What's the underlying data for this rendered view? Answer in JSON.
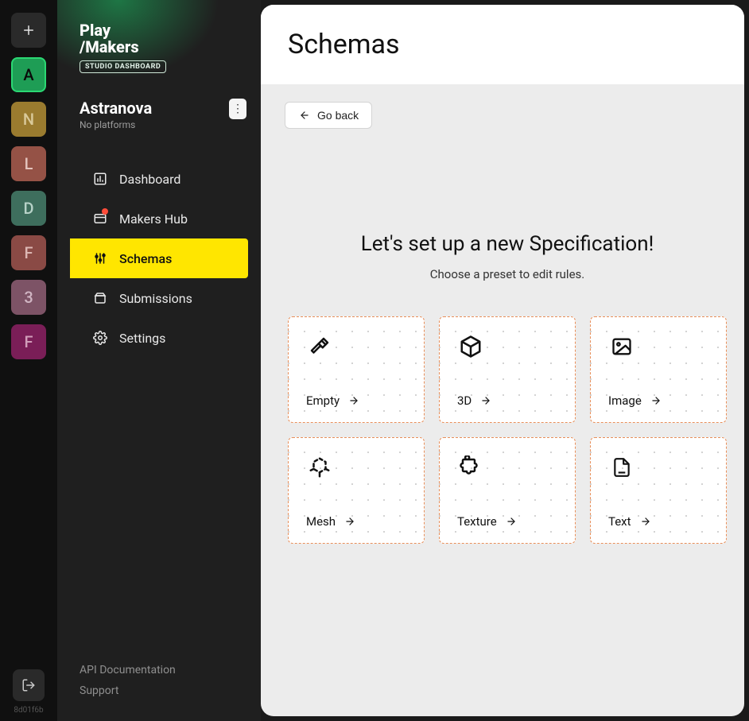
{
  "rail": {
    "tiles": [
      {
        "letter": "+",
        "bg": "#2a2a2a",
        "fg": "#e5e5e5",
        "active": false,
        "plus": true
      },
      {
        "letter": "A",
        "bg": "#1e9d55",
        "fg": "#0a0a0a",
        "active": true
      },
      {
        "letter": "N",
        "bg": "#9a7b2f",
        "fg": "#d9c999",
        "active": false
      },
      {
        "letter": "L",
        "bg": "#955246",
        "fg": "#e4c4bd",
        "active": false
      },
      {
        "letter": "D",
        "bg": "#3e6e5d",
        "fg": "#b7d2c8",
        "active": false
      },
      {
        "letter": "F",
        "bg": "#8a4a45",
        "fg": "#dcb7b3",
        "active": false
      },
      {
        "letter": "3",
        "bg": "#7d5366",
        "fg": "#d0b5c3",
        "active": false
      },
      {
        "letter": "F",
        "bg": "#7a1e57",
        "fg": "#d19dba",
        "active": false
      }
    ],
    "build_id": "8d01f6b"
  },
  "brand": {
    "line1": "Play",
    "line2": "/Makers",
    "badge": "STUDIO DASHBOARD"
  },
  "project": {
    "name": "Astranova",
    "subtitle": "No platforms"
  },
  "sidebar": {
    "items": [
      {
        "label": "Dashboard",
        "icon": "dashboard",
        "active": false,
        "notify": false
      },
      {
        "label": "Makers Hub",
        "icon": "hub",
        "active": false,
        "notify": true
      },
      {
        "label": "Schemas",
        "icon": "sliders",
        "active": true,
        "notify": false
      },
      {
        "label": "Submissions",
        "icon": "package",
        "active": false,
        "notify": false
      },
      {
        "label": "Settings",
        "icon": "gear",
        "active": false,
        "notify": false
      }
    ],
    "footer": {
      "api_docs": "API Documentation",
      "support": "Support"
    }
  },
  "page": {
    "title": "Schemas",
    "go_back": "Go back",
    "hero_title": "Let's set up a new Specification!",
    "hero_sub": "Choose a preset to edit rules.",
    "presets": [
      {
        "label": "Empty",
        "icon": "hammer"
      },
      {
        "label": "3D",
        "icon": "cube"
      },
      {
        "label": "Image",
        "icon": "image"
      },
      {
        "label": "Mesh",
        "icon": "mesh"
      },
      {
        "label": "Texture",
        "icon": "puzzle"
      },
      {
        "label": "Text",
        "icon": "file"
      }
    ]
  }
}
